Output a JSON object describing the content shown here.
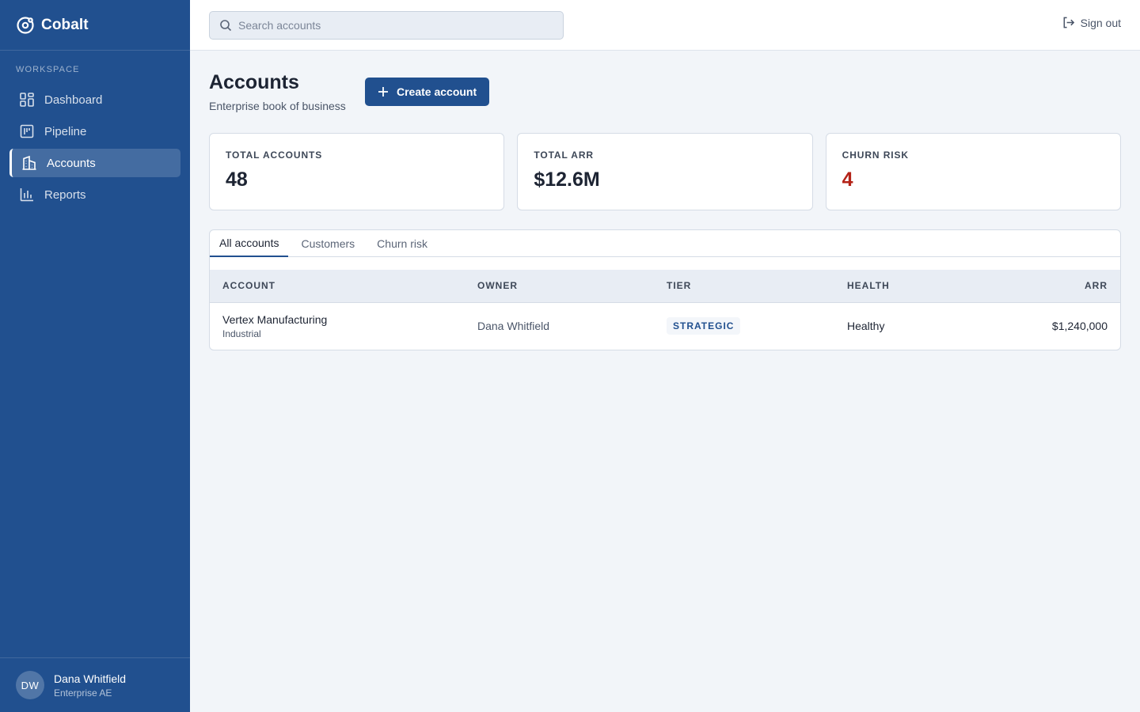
{
  "app": {
    "name": "Cobalt",
    "logo_icon": "cobalt-logo-icon",
    "accent": "#21508f",
    "danger": "#b42318"
  },
  "sidebar": {
    "section_label": "WORKSPACE",
    "items": [
      {
        "label": "Dashboard",
        "icon": "dashboard-icon",
        "active": false
      },
      {
        "label": "Pipeline",
        "icon": "pipeline-icon",
        "active": false
      },
      {
        "label": "Accounts",
        "icon": "building-icon",
        "active": true
      },
      {
        "label": "Reports",
        "icon": "bar-chart-icon",
        "active": false
      }
    ],
    "user": {
      "initials": "DW",
      "name": "Dana Whitfield",
      "role": "Enterprise AE"
    }
  },
  "topbar": {
    "search": {
      "placeholder": "Search accounts",
      "value": ""
    },
    "sign_out_label": "Sign out"
  },
  "page": {
    "title": "Accounts",
    "subtitle": "Enterprise book of business",
    "create_button_label": "Create account"
  },
  "stats": [
    {
      "label": "TOTAL ACCOUNTS",
      "value": "48"
    },
    {
      "label": "TOTAL ARR",
      "value": "$12.6M"
    },
    {
      "label": "CHURN RISK",
      "value": "4"
    }
  ],
  "tabs": [
    {
      "label": "All accounts",
      "active": true
    },
    {
      "label": "Customers",
      "active": false
    },
    {
      "label": "Churn risk",
      "active": false
    }
  ],
  "table": {
    "columns": [
      "ACCOUNT",
      "OWNER",
      "TIER",
      "HEALTH",
      "ARR"
    ],
    "rows": [
      {
        "account": "Vertex Manufacturing",
        "sector": "Industrial",
        "owner": "Dana Whitfield",
        "tier": "STRATEGIC",
        "health": "Healthy",
        "arr": "$1,240,000"
      }
    ]
  }
}
